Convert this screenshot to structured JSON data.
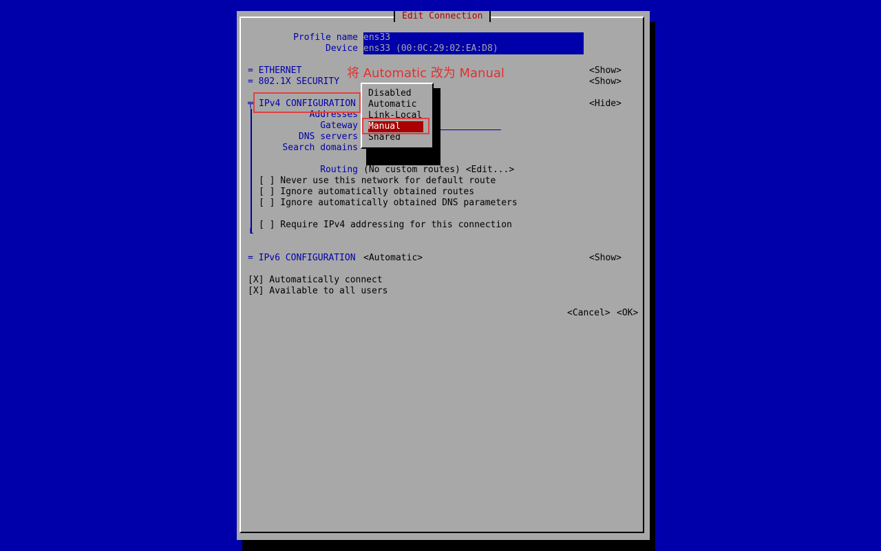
{
  "dialog": {
    "title": "Edit Connection"
  },
  "profile": {
    "name_label": "Profile name",
    "name_value": "ens33",
    "device_label": "Device",
    "device_value": "ens33 (00:0C:29:02:EA:D8)"
  },
  "sections": {
    "ethernet": {
      "label": "= ETHERNET",
      "action": "<Show>"
    },
    "security": {
      "label": "= 802.1X SECURITY",
      "action": "<Show>"
    },
    "ipv4": {
      "marker": "╤",
      "label": "IPv4 CONFIGURATION",
      "action": "<Hide>",
      "addresses_label": "Addresses",
      "gateway_label": "Gateway",
      "dns_label": "DNS servers",
      "search_label": "Search domains",
      "routing_label": "Routing",
      "routing_value": "(No custom routes) <Edit...>",
      "checkboxes": [
        "[ ] Never use this network for default route",
        "[ ] Ignore automatically obtained routes",
        "[ ] Ignore automatically obtained DNS parameters",
        "[ ] Require IPv4 addressing for this connection"
      ],
      "bottom_marker": "└"
    },
    "ipv6": {
      "label": "= IPv6 CONFIGURATION",
      "value": "<Automatic>",
      "action": "<Show>"
    }
  },
  "options": {
    "auto_connect": "[X] Automatically connect",
    "all_users": "[X] Available to all users"
  },
  "buttons": {
    "cancel": "<Cancel>",
    "ok": "<OK>"
  },
  "dropdown": {
    "items": [
      "Disabled",
      "Automatic",
      "Link-Local",
      "Manual",
      "Shared"
    ],
    "selected": "Manual"
  },
  "annotation": {
    "text": "将 Automatic 改为 Manual",
    "color": "#e03030"
  },
  "colors": {
    "background": "#0000aa",
    "dialog": "#a8a8a8",
    "accent": "#aa0000"
  }
}
